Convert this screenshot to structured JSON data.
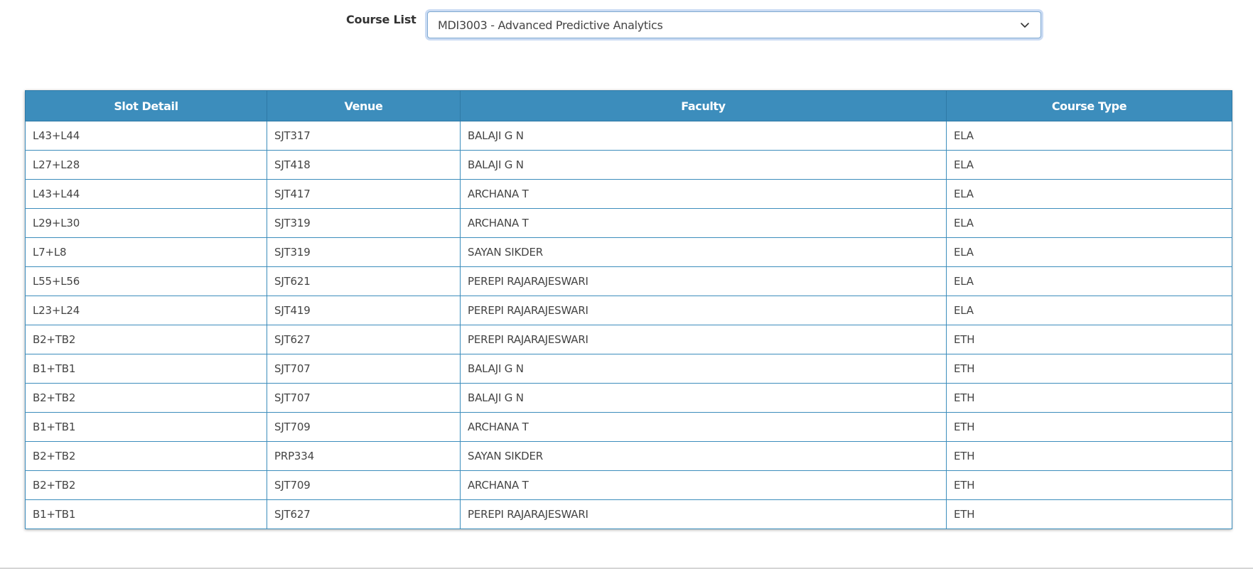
{
  "form": {
    "course_label": "Course List",
    "course_select_value": "MDI3003 - Advanced Predictive Analytics"
  },
  "table": {
    "headers": [
      "Slot Detail",
      "Venue",
      "Faculty",
      "Course Type"
    ],
    "rows": [
      [
        "L43+L44",
        "SJT317",
        "BALAJI G N",
        "ELA"
      ],
      [
        "L27+L28",
        "SJT418",
        "BALAJI G N",
        "ELA"
      ],
      [
        "L43+L44",
        "SJT417",
        "ARCHANA T",
        "ELA"
      ],
      [
        "L29+L30",
        "SJT319",
        "ARCHANA T",
        "ELA"
      ],
      [
        "L7+L8",
        "SJT319",
        "SAYAN SIKDER",
        "ELA"
      ],
      [
        "L55+L56",
        "SJT621",
        "PEREPI RAJARAJESWARI",
        "ELA"
      ],
      [
        "L23+L24",
        "SJT419",
        "PEREPI RAJARAJESWARI",
        "ELA"
      ],
      [
        "B2+TB2",
        "SJT627",
        "PEREPI RAJARAJESWARI",
        "ETH"
      ],
      [
        "B1+TB1",
        "SJT707",
        "BALAJI G N",
        "ETH"
      ],
      [
        "B2+TB2",
        "SJT707",
        "BALAJI G N",
        "ETH"
      ],
      [
        "B1+TB1",
        "SJT709",
        "ARCHANA T",
        "ETH"
      ],
      [
        "B2+TB2",
        "PRP334",
        "SAYAN SIKDER",
        "ETH"
      ],
      [
        "B2+TB2",
        "SJT709",
        "ARCHANA T",
        "ETH"
      ],
      [
        "B1+TB1",
        "SJT627",
        "PEREPI RAJARAJESWARI",
        "ETH"
      ]
    ]
  },
  "icons": {
    "select_arrow": "chevron-down-icon"
  },
  "colors": {
    "header_bg": "#3c8dbc",
    "header_text": "#ffffff",
    "border": "#3c8dbc",
    "focus_ring": "#7fa9d1"
  }
}
